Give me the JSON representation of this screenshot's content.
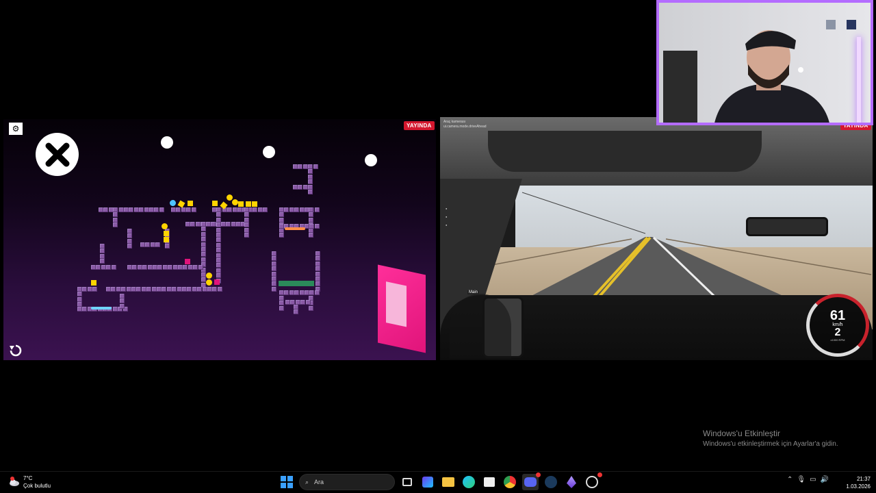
{
  "game": {
    "gear_icon": "gear-icon",
    "close_icon": "close-icon",
    "undo_icon": "undo-icon",
    "live_badge": "YAYINDA"
  },
  "drive": {
    "camera_title": "Araç kamerası",
    "camera_mode": "ui.camera.mode.driveAhead",
    "minimap_label": "Main",
    "speed": "61",
    "speed_unit": "km/h",
    "gear": "2",
    "rpm_unit": "x1000 RPM",
    "live_badge": "YAYINDA"
  },
  "watermark": {
    "title": "Windows'u Etkinleştir",
    "subtitle": "Windows'u etkinleştirmek için Ayarlar'a gidin."
  },
  "taskbar": {
    "weather_temp": "7°C",
    "weather_desc": "Çok bulutlu",
    "search_placeholder": "Ara",
    "time": "21:37",
    "date": "1.03.2026",
    "accent": "#b46cff"
  }
}
